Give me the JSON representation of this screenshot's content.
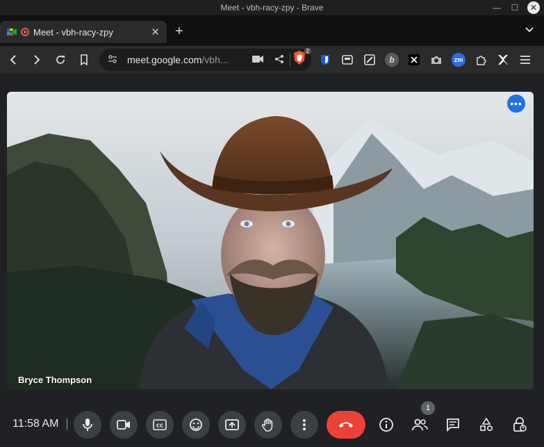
{
  "window": {
    "title": "Meet - vbh-racy-zpy - Brave"
  },
  "tab": {
    "title": "Meet - vbh-racy-zpy"
  },
  "toolbar": {
    "url_host": "meet.google.com",
    "url_rest": "/vbh...",
    "brave_badge": "2"
  },
  "extensions": [
    "bitwarden-icon",
    "reader-icon",
    "edit-icon",
    "b-icon",
    "x-icon",
    "camera-icon",
    "zm-icon",
    "puzzle-icon",
    "sparkle-icon"
  ],
  "extensions_text": {
    "zm": "zm",
    "b": "b"
  },
  "video": {
    "participant_name": "Bryce Thompson"
  },
  "controls": {
    "time": "11:58 AM",
    "participants_count": "1"
  },
  "colors": {
    "end_call": "#ea4335",
    "more_button": "#1a73e8",
    "control_bg": "#3c4043"
  }
}
